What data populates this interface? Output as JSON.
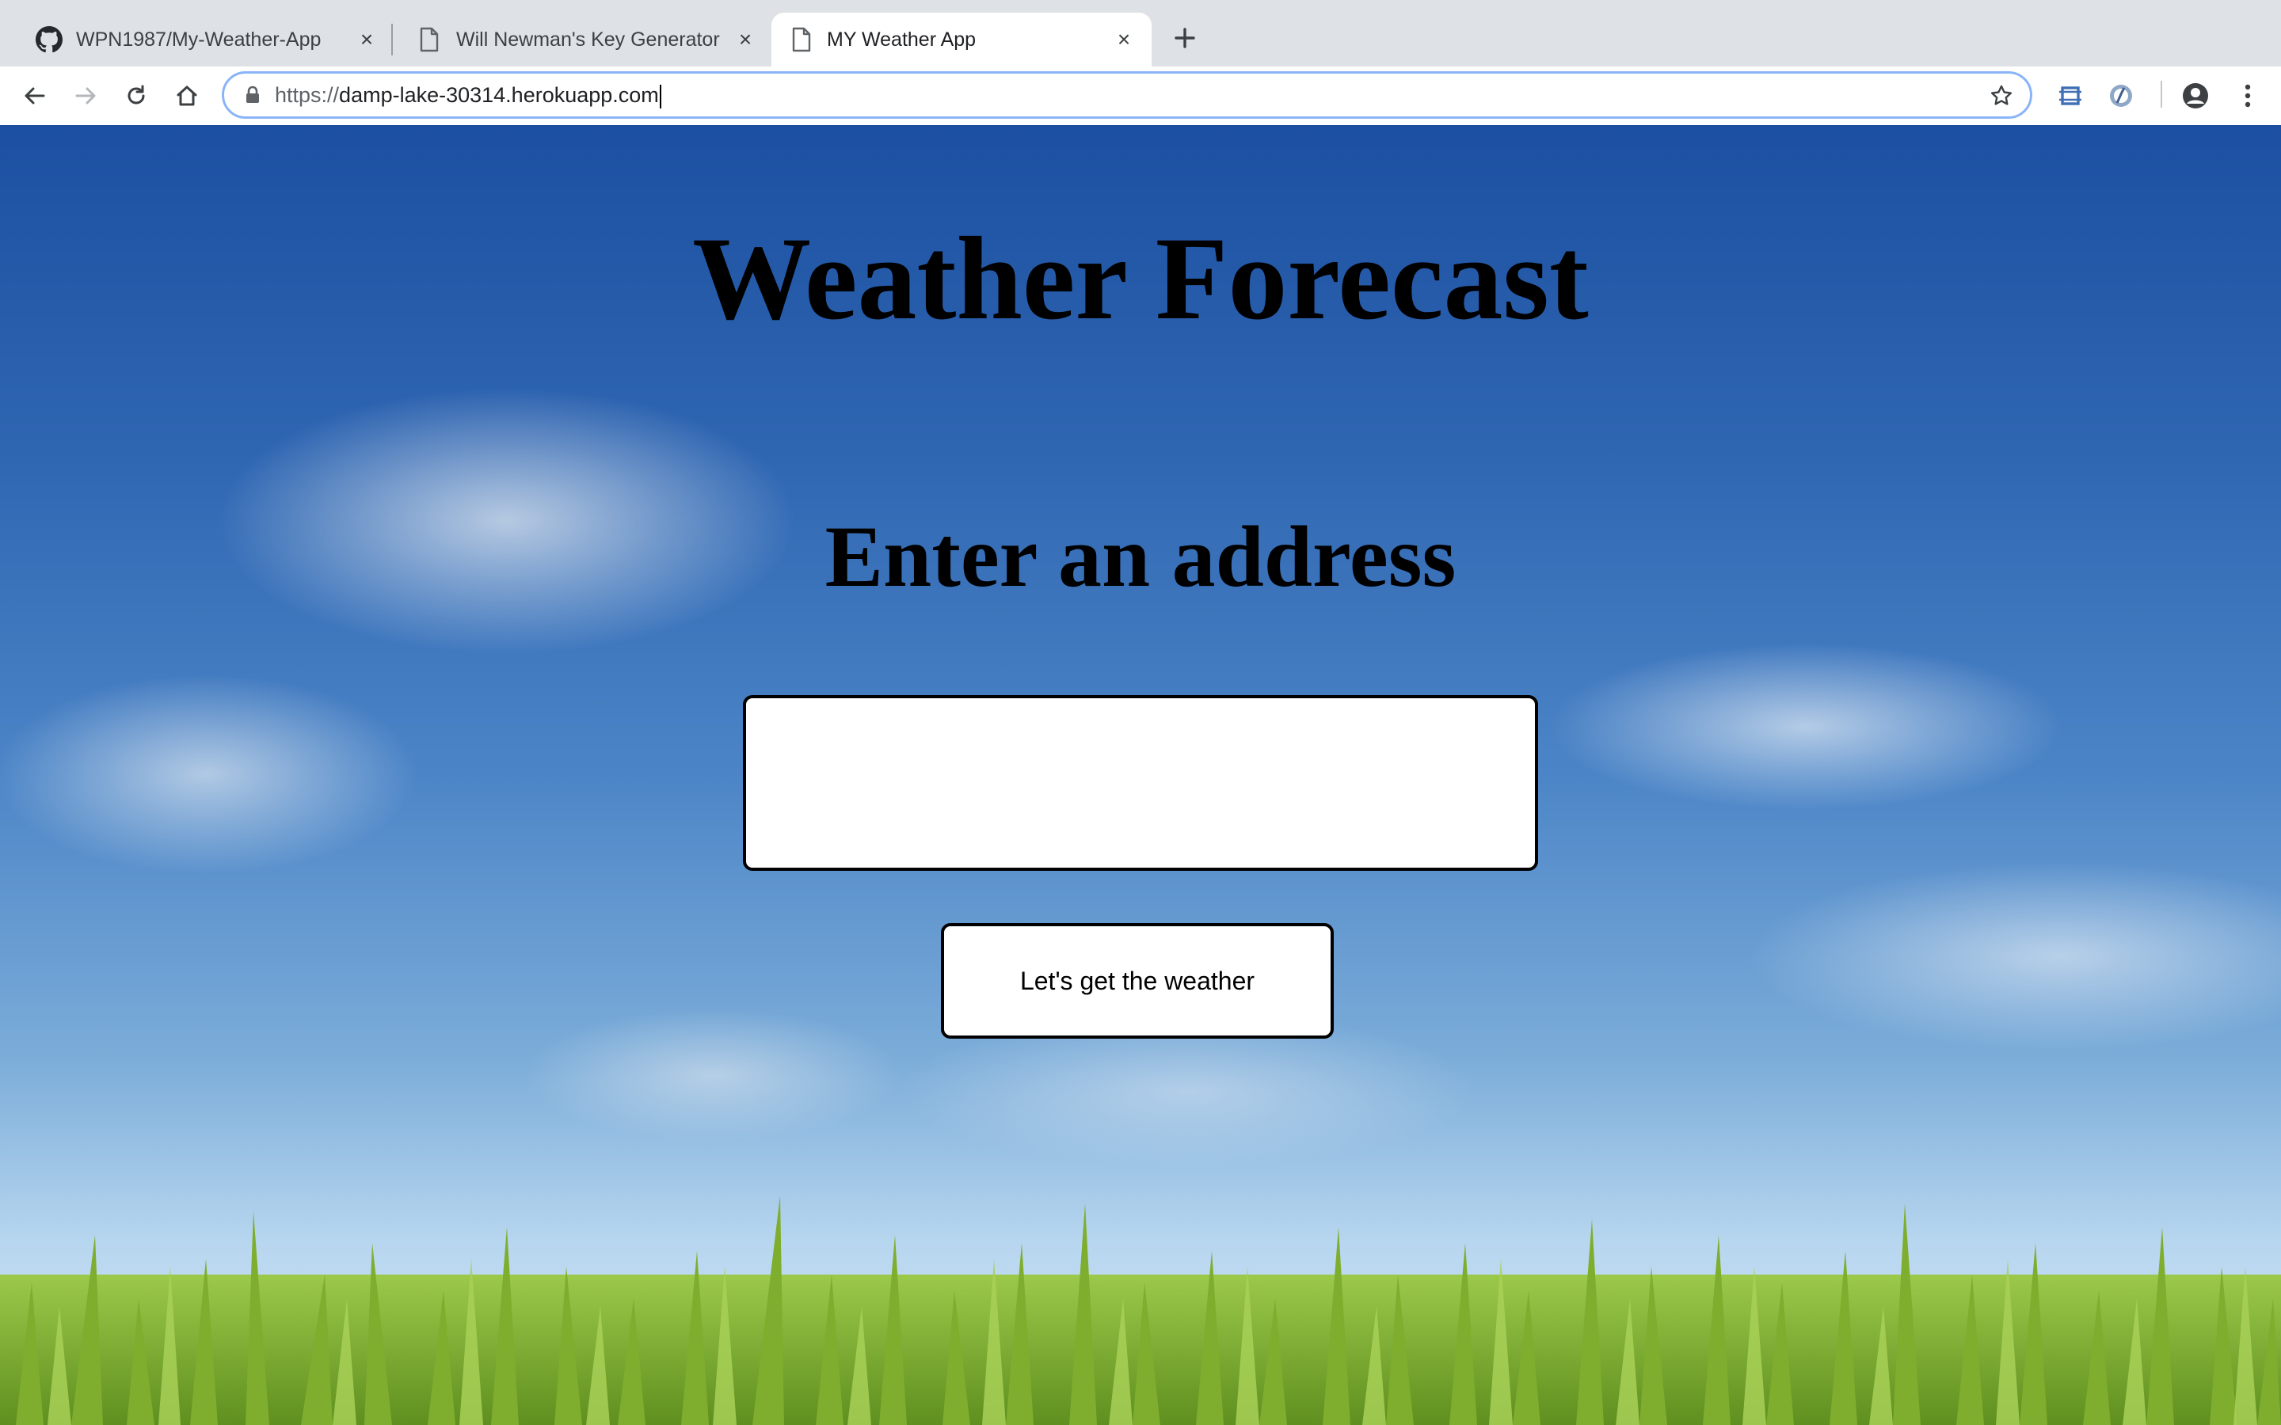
{
  "browser": {
    "tabs": [
      {
        "title": "WPN1987/My-Weather-App",
        "icon": "github-icon",
        "active": false
      },
      {
        "title": "Will Newman's Key Generator",
        "icon": "document-icon",
        "active": false
      },
      {
        "title": "MY Weather App",
        "icon": "document-icon",
        "active": true
      }
    ],
    "address_bar": {
      "scheme": "https://",
      "host": "damp-lake-30314.herokuapp.com"
    },
    "toolbar_icons": [
      "back-arrow-icon",
      "forward-arrow-icon",
      "reload-icon",
      "home-icon",
      "lock-icon",
      "bookmark-star-icon",
      "extension-crop-icon",
      "extension-circle-icon",
      "profile-icon",
      "menu-kebab-icon"
    ]
  },
  "page": {
    "title": "Weather Forecast",
    "subtitle": "Enter an address",
    "address_input": {
      "value": "",
      "placeholder": ""
    },
    "submit_label": "Let's get the weather"
  },
  "colors": {
    "tabstrip": "#dee1e6",
    "omnibox_focus": "#8ab4f8",
    "sky_top": "#1c4fa1",
    "sky_bottom": "#d5e7f5",
    "grass": "#7fae2e"
  }
}
